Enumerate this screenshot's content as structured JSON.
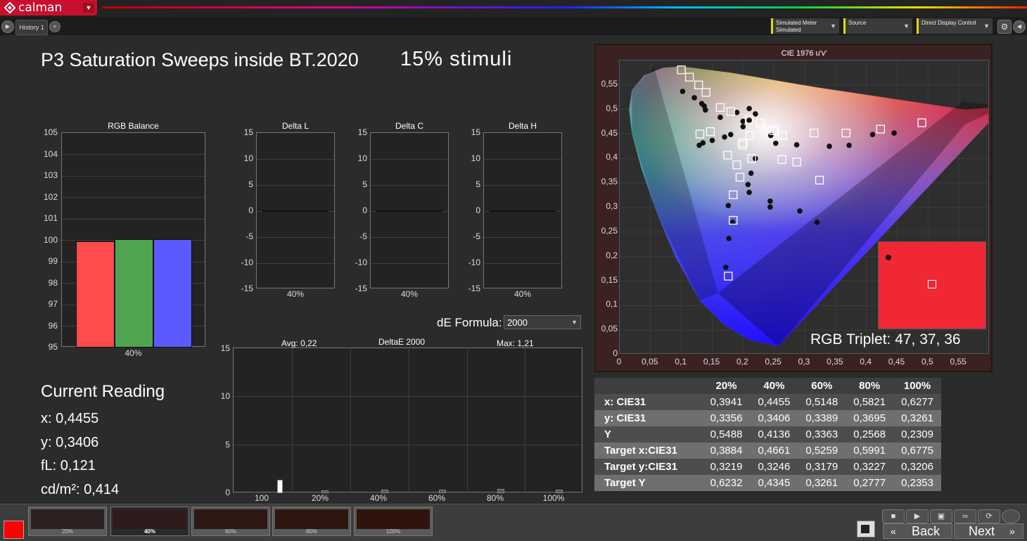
{
  "app": {
    "logo_text": "calman"
  },
  "tabs": [
    {
      "label": "History 1"
    }
  ],
  "controls": {
    "meter_label": "Simulated Meter",
    "meter_value": "Simulated",
    "source_label": "Source",
    "display_label": "Direct Display Control"
  },
  "header": {
    "title": "P3 Saturation Sweeps inside BT.2020",
    "stimuli": "15% stimuli"
  },
  "rgb_balance": {
    "title": "RGB Balance",
    "yticks": [
      "105",
      "104",
      "103",
      "102",
      "101",
      "100",
      "99",
      "98",
      "97",
      "96",
      "95"
    ],
    "xlabel": "40%",
    "colors": {
      "r": "#ff4b4b",
      "g": "#4fa54f",
      "b": "#5a5aff"
    }
  },
  "delta_charts": [
    {
      "title": "Delta L",
      "xlabel": "40%"
    },
    {
      "title": "Delta C",
      "xlabel": "40%"
    },
    {
      "title": "Delta H",
      "xlabel": "40%"
    }
  ],
  "delta_yticks": [
    "15",
    "10",
    "5",
    "0",
    "-5",
    "-10",
    "-15"
  ],
  "current_reading": {
    "title": "Current Reading",
    "x": "x: 0,4455",
    "y": "y: 0,3406",
    "fl": "fL: 0,121",
    "cdm2": "cd/m²: 0,414"
  },
  "de_formula": {
    "label": "dE Formula:",
    "value": "2000"
  },
  "deltae_chart": {
    "title": "DeltaE 2000",
    "avg": "Avg: 0,22",
    "max": "Max: 1,21",
    "yticks": [
      "15",
      "10",
      "5",
      "0"
    ],
    "xlabels": [
      "100",
      "20%",
      "40%",
      "60%",
      "80%",
      "100%"
    ]
  },
  "cie": {
    "title": "CIE 1976 u'v'",
    "yticks": [
      "0,55",
      "0,5",
      "0,45",
      "0,4",
      "0,35",
      "0,3",
      "0,25",
      "0,2",
      "0,15",
      "0,1",
      "0,05",
      "0"
    ],
    "xticks": [
      "0",
      "0,05",
      "0,1",
      "0,15",
      "0,2",
      "0,25",
      "0,3",
      "0,35",
      "0,4",
      "0,45",
      "0,5",
      "0,55"
    ],
    "triplet": "RGB Triplet: 47, 37, 36",
    "swatch_color": "#f02836"
  },
  "table": {
    "headers": [
      "",
      "20%",
      "40%",
      "60%",
      "80%",
      "100%"
    ],
    "rows": [
      [
        "x: CIE31",
        "0,3941",
        "0,4455",
        "0,5148",
        "0,5821",
        "0,6277"
      ],
      [
        "y: CIE31",
        "0,3356",
        "0,3406",
        "0,3389",
        "0,3695",
        "0,3261"
      ],
      [
        "Y",
        "0,5488",
        "0,4136",
        "0,3363",
        "0,2568",
        "0,2309"
      ],
      [
        "Target x:CIE31",
        "0,3884",
        "0,4661",
        "0,5259",
        "0,5991",
        "0,6775"
      ],
      [
        "Target y:CIE31",
        "0,3219",
        "0,3246",
        "0,3179",
        "0,3227",
        "0,3206"
      ],
      [
        "Target Y",
        "0,6232",
        "0,4345",
        "0,3261",
        "0,2777",
        "0,2353"
      ]
    ]
  },
  "patches": [
    {
      "label": "20%",
      "color": "#2c2020"
    },
    {
      "label": "40%",
      "color": "#2e1c1c"
    },
    {
      "label": "60%",
      "color": "#2e1814"
    },
    {
      "label": "80%",
      "color": "#2e1610"
    },
    {
      "label": "100%",
      "color": "#2e140c"
    }
  ],
  "nav": {
    "back": "Back",
    "next": "Next"
  },
  "chart_data": [
    {
      "type": "bar",
      "title": "RGB Balance",
      "categories": [
        "40%"
      ],
      "series": [
        {
          "values": [
            99.9
          ]
        },
        {
          "values": [
            100.0
          ]
        },
        {
          "values": [
            99.98
          ]
        }
      ],
      "ylim": [
        95,
        105
      ]
    },
    {
      "type": "bar",
      "title": "Delta L",
      "categories": [
        "40%"
      ],
      "values": [
        0.0
      ],
      "ylim": [
        -15,
        15
      ]
    },
    {
      "type": "bar",
      "title": "Delta C",
      "categories": [
        "40%"
      ],
      "values": [
        0.0
      ],
      "ylim": [
        -15,
        15
      ]
    },
    {
      "type": "bar",
      "title": "Delta H",
      "categories": [
        "40%"
      ],
      "values": [
        0.0
      ],
      "ylim": [
        -15,
        15
      ]
    },
    {
      "type": "bar",
      "title": "DeltaE 2000",
      "categories": [
        "100",
        "20%",
        "40%",
        "60%",
        "80%",
        "100%"
      ],
      "values": [
        1.21,
        0.15,
        0.2,
        0.25,
        0.3,
        0.2
      ],
      "ylim": [
        0,
        15
      ]
    },
    {
      "type": "scatter",
      "title": "CIE 1976 u'v'",
      "xlim": [
        0,
        0.6
      ],
      "ylim": [
        0,
        0.6
      ],
      "series": [
        {
          "marker": "dot",
          "points": [
            [
              0.102,
              0.537
            ],
            [
              0.121,
              0.524
            ],
            [
              0.133,
              0.512
            ],
            [
              0.137,
              0.507
            ],
            [
              0.139,
              0.499
            ],
            [
              0.163,
              0.484
            ],
            [
              0.19,
              0.494
            ],
            [
              0.21,
              0.502
            ],
            [
              0.22,
              0.491
            ],
            [
              0.21,
              0.478
            ],
            [
              0.2,
              0.465
            ],
            [
              0.18,
              0.449
            ],
            [
              0.17,
              0.444
            ],
            [
              0.15,
              0.437
            ],
            [
              0.135,
              0.432
            ],
            [
              0.129,
              0.427
            ],
            [
              0.245,
              0.447
            ],
            [
              0.253,
              0.431
            ],
            [
              0.287,
              0.428
            ],
            [
              0.34,
              0.425
            ],
            [
              0.372,
              0.427
            ],
            [
              0.41,
              0.449
            ],
            [
              0.445,
              0.452
            ],
            [
              0.22,
              0.4
            ],
            [
              0.213,
              0.37
            ],
            [
              0.208,
              0.347
            ],
            [
              0.21,
              0.331
            ],
            [
              0.244,
              0.313
            ],
            [
              0.244,
              0.301
            ],
            [
              0.292,
              0.293
            ],
            [
              0.32,
              0.27
            ],
            [
              0.183,
              0.27
            ],
            [
              0.177,
              0.237
            ],
            [
              0.172,
              0.178
            ],
            [
              0.176,
              0.304
            ],
            [
              0.44,
              0.197
            ],
            [
              0.2,
              0.476
            ]
          ]
        },
        {
          "marker": "square",
          "points": [
            [
              0.1,
              0.581
            ],
            [
              0.113,
              0.566
            ],
            [
              0.128,
              0.55
            ],
            [
              0.14,
              0.535
            ],
            [
              0.163,
              0.504
            ],
            [
              0.18,
              0.496
            ],
            [
              0.21,
              0.48
            ],
            [
              0.228,
              0.473
            ],
            [
              0.25,
              0.457
            ],
            [
              0.264,
              0.447
            ],
            [
              0.315,
              0.452
            ],
            [
              0.367,
              0.452
            ],
            [
              0.423,
              0.46
            ],
            [
              0.49,
              0.473
            ],
            [
              0.199,
              0.428
            ],
            [
              0.211,
              0.447
            ],
            [
              0.175,
              0.407
            ],
            [
              0.19,
              0.387
            ],
            [
              0.195,
              0.362
            ],
            [
              0.184,
              0.326
            ],
            [
              0.184,
              0.274
            ],
            [
              0.287,
              0.393
            ],
            [
              0.324,
              0.356
            ],
            [
              0.263,
              0.398
            ],
            [
              0.214,
              0.4
            ],
            [
              0.2,
              0.432
            ],
            [
              0.176,
              0.16
            ],
            [
              0.13,
              0.45
            ],
            [
              0.147,
              0.455
            ]
          ]
        }
      ]
    }
  ]
}
